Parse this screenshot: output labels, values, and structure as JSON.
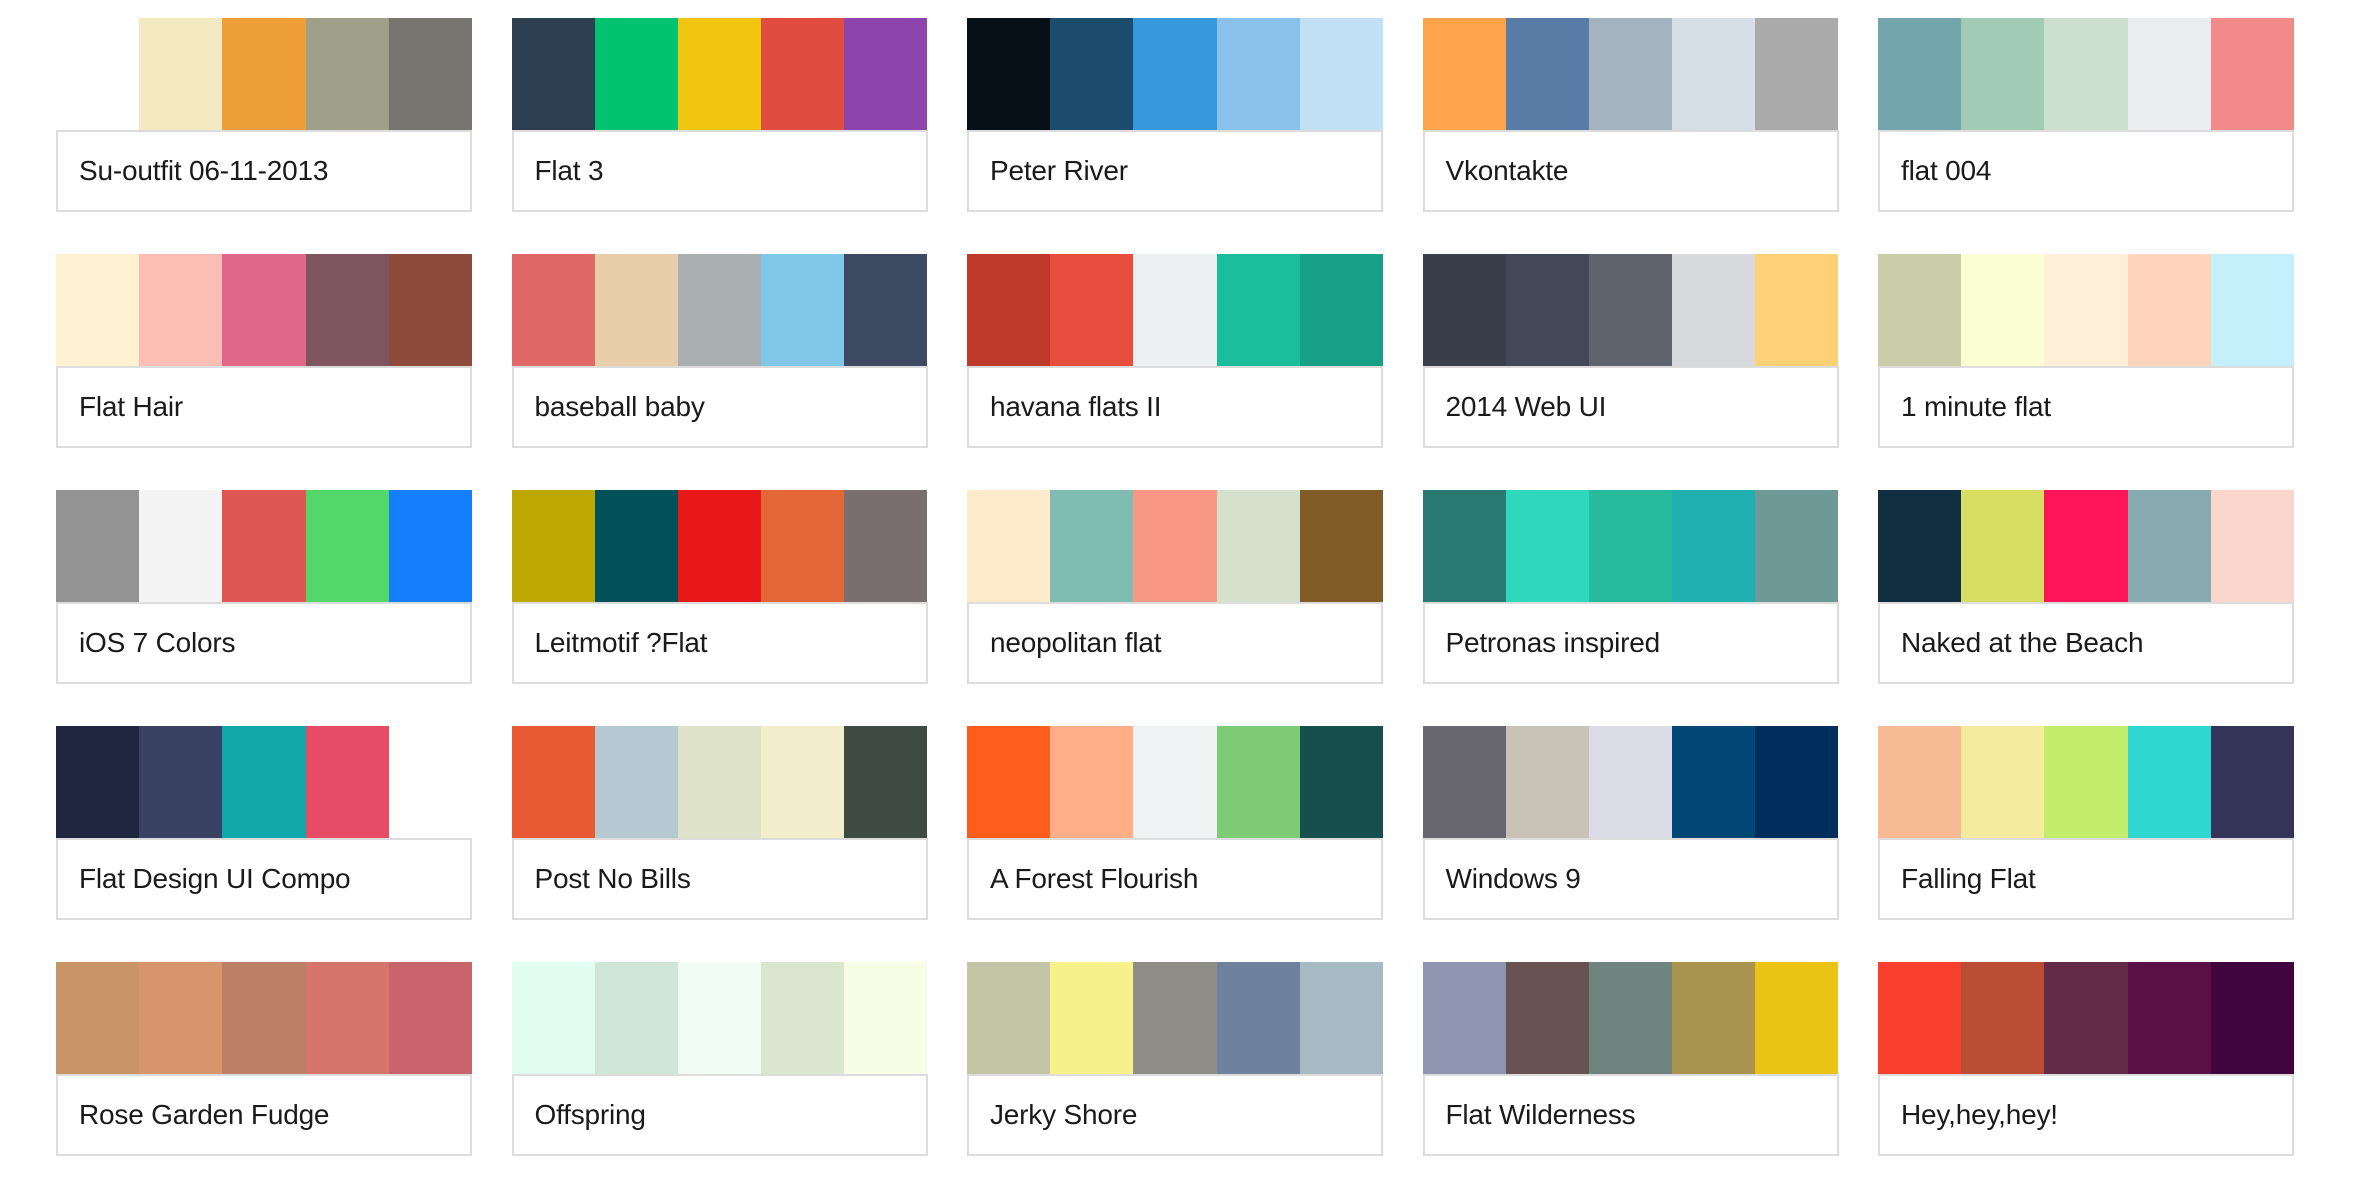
{
  "palettes": [
    {
      "name": "Su-outfit 06-11-2013",
      "colors": [
        "#FFFFFF",
        "#F3EAC2",
        "#EE9E38",
        "#A09F8A",
        "#75746F"
      ]
    },
    {
      "name": "Flat 3",
      "colors": [
        "#2D3E50",
        "#00C372",
        "#F2C511",
        "#E14C40",
        "#8D44AD"
      ]
    },
    {
      "name": "Peter River",
      "colors": [
        "#070F17",
        "#1B4C6C",
        "#3799DC",
        "#88C2EA",
        "#C1E0F5"
      ]
    },
    {
      "name": "Vkontakte",
      "colors": [
        "#FEA44A",
        "#587CA6",
        "#A4B3C0",
        "#D6DFE6",
        "#AAAAAA"
      ]
    },
    {
      "name": "flat 004",
      "colors": [
        "#72A6AC",
        "#A2CBB6",
        "#CDE0CD",
        "#ECEDF1",
        "#F28A89"
      ]
    },
    {
      "name": "Flat Hair",
      "colors": [
        "#FEF2D3",
        "#FBBDB4",
        "#E16788",
        "#7E5461",
        "#8E4A3B"
      ]
    },
    {
      "name": "baseball baby",
      "colors": [
        "#E06867",
        "#E9CEAB",
        "#A9AEB0",
        "#80C6E6",
        "#3E4A61"
      ]
    },
    {
      "name": "havana flats II",
      "colors": [
        "#C03A2B",
        "#E84E3E",
        "#ECF0F1",
        "#1BBE9B",
        "#16A085"
      ]
    },
    {
      "name": "2014 Web UI",
      "colors": [
        "#3A3E4B",
        "#424858",
        "#5E636E",
        "#D8D9DD",
        "#FFD177"
      ]
    },
    {
      "name": "1 minute flat",
      "colors": [
        "#C9CDA9",
        "#FCFED3",
        "#FDEFD8",
        "#FFD3BC",
        "#C6EFFC"
      ]
    },
    {
      "name": "iOS 7 Colors",
      "colors": [
        "#939393",
        "#F4F4F4",
        "#E05652",
        "#53D769",
        "#157EFB"
      ]
    },
    {
      "name": "Leitmotif ?Flat",
      "colors": [
        "#BCA800",
        "#025159",
        "#E81818",
        "#E36737",
        "#7A6E6E"
      ]
    },
    {
      "name": "neopolitan flat",
      "colors": [
        "#FDEBCB",
        "#7FBCB2",
        "#F89884",
        "#D6E1CD",
        "#825C26"
      ]
    },
    {
      "name": "Petronas inspired",
      "colors": [
        "#2A7A74",
        "#2FD8BC",
        "#27BA9D",
        "#20B0B0",
        "#6E9996"
      ]
    },
    {
      "name": "Naked at the Beach",
      "colors": [
        "#112F41",
        "#D8DE62",
        "#FF1458",
        "#87A9B0",
        "#FAD6CC"
      ]
    },
    {
      "name": "Flat Design UI Compo",
      "colors": [
        "#202540",
        "#394263",
        "#11A8AB",
        "#E64C66",
        "#FFFFFF"
      ]
    },
    {
      "name": "Post No Bills",
      "colors": [
        "#E85A34",
        "#B6C9D2",
        "#DDE2C8",
        "#F2EDCB",
        "#3E4B45"
      ]
    },
    {
      "name": "A Forest Flourish",
      "colors": [
        "#FF5D1B",
        "#FFAE88",
        "#EEF2F3",
        "#7DCB77",
        "#174E4E"
      ]
    },
    {
      "name": "Windows 9",
      "colors": [
        "#686770",
        "#C8C2B7",
        "#DBDBE5",
        "#004776",
        "#002E5C"
      ]
    },
    {
      "name": "Falling Flat",
      "colors": [
        "#F8BA94",
        "#F5EB9E",
        "#C2ED6D",
        "#2FD7D1",
        "#343458"
      ]
    },
    {
      "name": "Rose Garden Fudge",
      "colors": [
        "#C99466",
        "#D6956A",
        "#BE7F68",
        "#D6756C",
        "#C9646C"
      ]
    },
    {
      "name": "Offspring",
      "colors": [
        "#E2FDF1",
        "#D0E6D8",
        "#F1FCF4",
        "#DBE6D1",
        "#F8FEE6"
      ]
    },
    {
      "name": "Jerky Shore",
      "colors": [
        "#C4C4A6",
        "#F6F18A",
        "#8E8D87",
        "#6E819D",
        "#A7BAC3"
      ]
    },
    {
      "name": "Flat Wilderness",
      "colors": [
        "#8D95B0",
        "#695252",
        "#6F837F",
        "#A9944F",
        "#EAC415"
      ]
    },
    {
      "name": "Hey,hey,hey!",
      "colors": [
        "#F83F2E",
        "#B94E35",
        "#632B47",
        "#5B1145",
        "#40043E"
      ]
    }
  ]
}
